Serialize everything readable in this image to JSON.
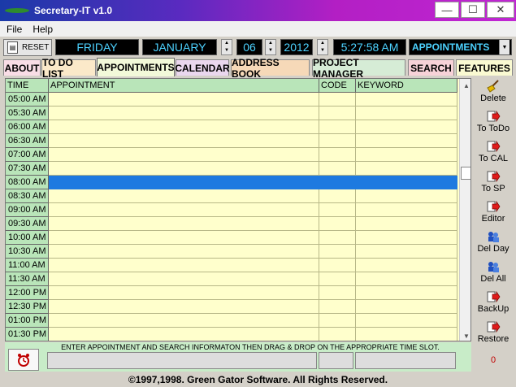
{
  "window": {
    "title": "Secretary-IT v1.0",
    "minimize": "—",
    "maximize": "☐",
    "close": "✕"
  },
  "menu": {
    "items": [
      "File",
      "Help"
    ]
  },
  "toolbar": {
    "reset_label": "RESET",
    "day": "FRIDAY",
    "month": "JANUARY",
    "date": "06",
    "year": "2012",
    "time": "5:27:58 AM",
    "view": "APPOINTMENTS"
  },
  "tabs": [
    {
      "label": "ABOUT",
      "color": "#f9dde6"
    },
    {
      "label": "TO DO LIST",
      "color": "#fbe9c9"
    },
    {
      "label": "APPOINTMENTS",
      "color": "#f2f9d9",
      "active": true
    },
    {
      "label": "CALENDAR",
      "color": "#ead7ee"
    },
    {
      "label": "ADDRESS BOOK",
      "color": "#f6d9b8"
    },
    {
      "label": "PROJECT MANAGER",
      "color": "#d6ecd6"
    },
    {
      "label": "SEARCH",
      "color": "#f7d2d8"
    },
    {
      "label": "FEATURES",
      "color": "#fafad2"
    }
  ],
  "grid": {
    "columns": [
      "TIME",
      "APPOINTMENT",
      "CODE",
      "KEYWORD"
    ],
    "times": [
      "05:00 AM",
      "05:30 AM",
      "06:00 AM",
      "06:30 AM",
      "07:00 AM",
      "07:30 AM",
      "08:00 AM",
      "08:30 AM",
      "09:00 AM",
      "09:30 AM",
      "10:00 AM",
      "10:30 AM",
      "11:00 AM",
      "11:30 AM",
      "12:00 PM",
      "12:30 PM",
      "01:00 PM",
      "01:30 PM"
    ],
    "selected_index": 6
  },
  "sidebar": [
    {
      "label": "Delete",
      "icon": "broom-icon"
    },
    {
      "label": "To ToDo",
      "icon": "arrow-right-icon"
    },
    {
      "label": "To CAL",
      "icon": "arrow-right-icon"
    },
    {
      "label": "To SP",
      "icon": "arrow-right-icon"
    },
    {
      "label": "Editor",
      "icon": "arrow-right-icon"
    },
    {
      "label": "Del Day",
      "icon": "people-icon"
    },
    {
      "label": "Del All",
      "icon": "people-icon"
    },
    {
      "label": "BackUp",
      "icon": "arrow-right-icon"
    },
    {
      "label": "Restore",
      "icon": "arrow-right-icon"
    }
  ],
  "counter": "0",
  "bottom": {
    "hint": "ENTER APPOINTMENT AND SEARCH INFORMATON THEN DRAG & DROP ON THE APPROPRIATE TIME SLOT."
  },
  "footer": "©1997,1998.  Green Gator Software.  All Rights Reserved."
}
